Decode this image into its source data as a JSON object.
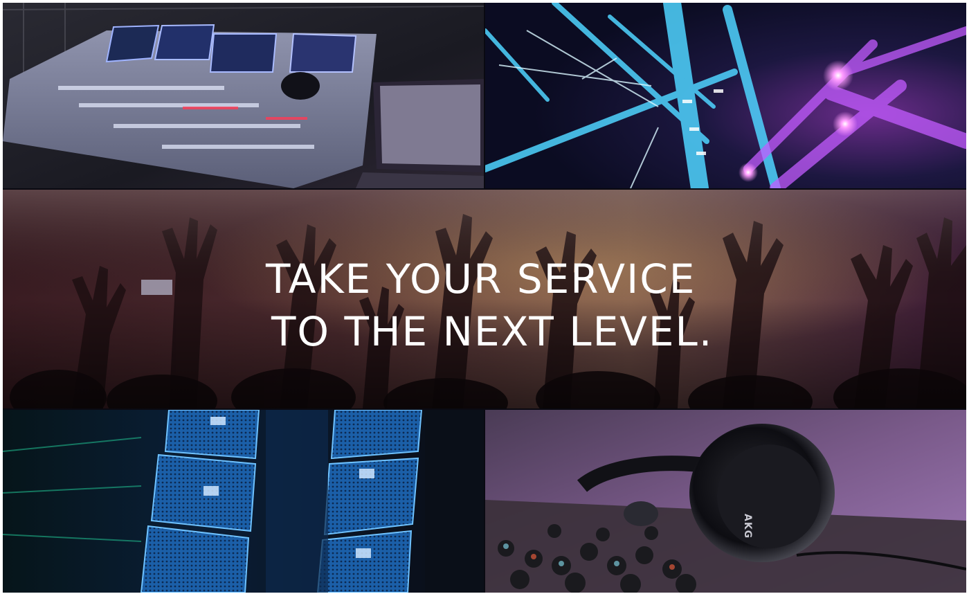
{
  "headline": {
    "line1": "TAKE YOUR SERVICE",
    "line2": "TO THE NEXT LEVEL."
  },
  "headphones": {
    "brand": "AKG"
  },
  "colors": {
    "background": "#0a0a12",
    "headline_text": "#ffffff",
    "stage_blue": "#29b6ff",
    "stage_purple": "#b23bd6",
    "crowd_tint": "#5a2a3a",
    "speaker_blue": "#1f7fd6"
  },
  "images": [
    {
      "name": "mixing-console-photo"
    },
    {
      "name": "stage-lights-photo"
    },
    {
      "name": "crowd-hands-photo"
    },
    {
      "name": "line-array-speakers-photo"
    },
    {
      "name": "headphones-on-mixer-photo"
    }
  ]
}
